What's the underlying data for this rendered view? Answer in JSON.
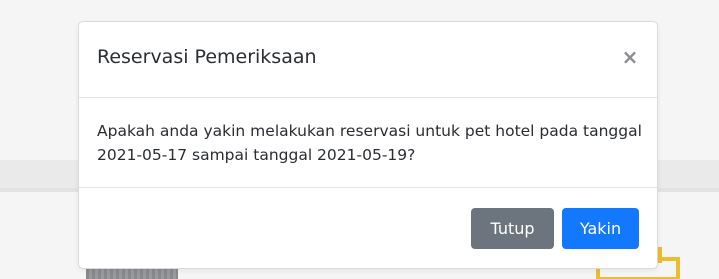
{
  "modal": {
    "title": "Reservasi Pemeriksaan",
    "close_glyph": "×",
    "message": "Apakah anda yakin melakukan reservasi untuk pet hotel pada tanggal 2021-05-17 sampai tanggal 2021-05-19?",
    "cancel_label": "Tutup",
    "confirm_label": "Yakin"
  },
  "colors": {
    "primary": "#1279ff",
    "secondary": "#6c757d",
    "text": "#2a2d31"
  },
  "icons": {
    "close": "close-icon"
  }
}
